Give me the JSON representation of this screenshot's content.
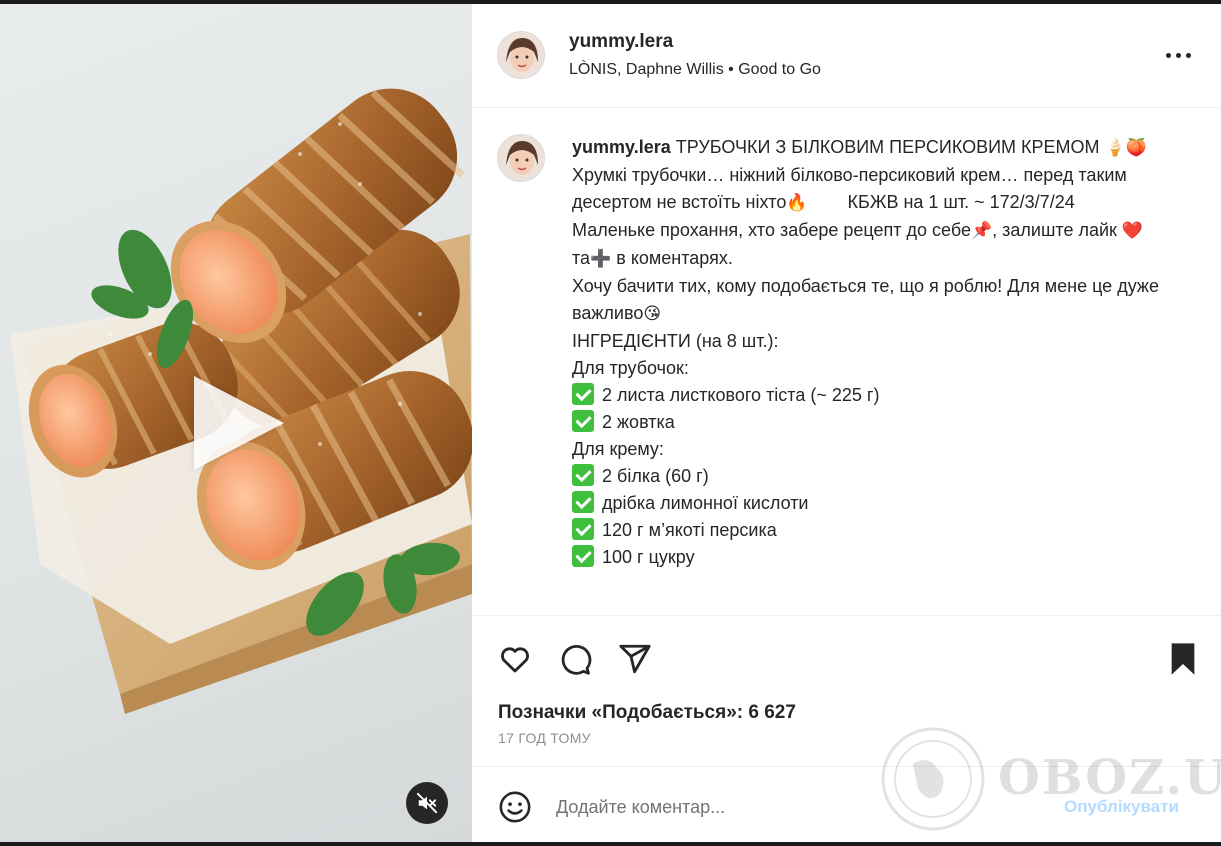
{
  "post": {
    "username": "yummy.lera",
    "audio": "LÒNIS, Daphne Willis • Good to Go"
  },
  "caption": {
    "username": "yummy.lera",
    "title": "ТРУБОЧКИ З БІЛКОВИМ ПЕРСИКОВИМ КРЕМОМ",
    "title_emoji": "🍦🍑",
    "p1": "Хрумкі трубочки… ніжний білково-персиковий крем… перед таким десертом не встоїть ніхто",
    "p1_emoji": "🔥",
    "p1_tail": "КБЖВ на 1 шт. ~ 172/3/7/24",
    "p2_a": "Маленьке прохання, хто забере рецепт до себе",
    "p2_emoji_pin": "📌",
    "p2_b": ", залиште лайк",
    "p2_emoji_heart": "❤️",
    "p2_c": "та",
    "p2_emoji_plus": "➕",
    "p2_d": "в коментарях.",
    "p3": "Хочу бачити тих, кому подобається те, що я роблю! Для мене це дуже важливо",
    "p3_emoji": "😘",
    "ingredients_title": "ІНГРЕДІЄНТИ (на 8 шт.):",
    "tubes_title": "Для трубочок:",
    "tubes_items": [
      "2 листа листкового тіста (~ 225 г)",
      "2 жовтка"
    ],
    "cream_title": "Для крему:",
    "cream_items": [
      "2 білка (60 г)",
      "дрібка лимонної кислоти",
      "120 г м’якоті персика",
      "100 г цукру"
    ]
  },
  "actions": {
    "likes": "Позначки «Подобається»: 6 627",
    "time": "17 ГОД ТОМУ"
  },
  "comment": {
    "placeholder": "Додайте коментар...",
    "publish": "Опублікувати"
  },
  "watermark": "OBOZ.UA",
  "icons": {
    "more": "more-options-icon",
    "like": "heart-icon",
    "comment": "comment-icon",
    "share": "share-icon",
    "save": "bookmark-icon",
    "emoji": "emoji-icon",
    "play": "play-icon",
    "mute": "muted-speaker-icon"
  },
  "colors": {
    "publish_disabled": "#b3dbff",
    "check_green": "#3ec03e",
    "text": "#262626",
    "muted": "#8e8e8e"
  }
}
